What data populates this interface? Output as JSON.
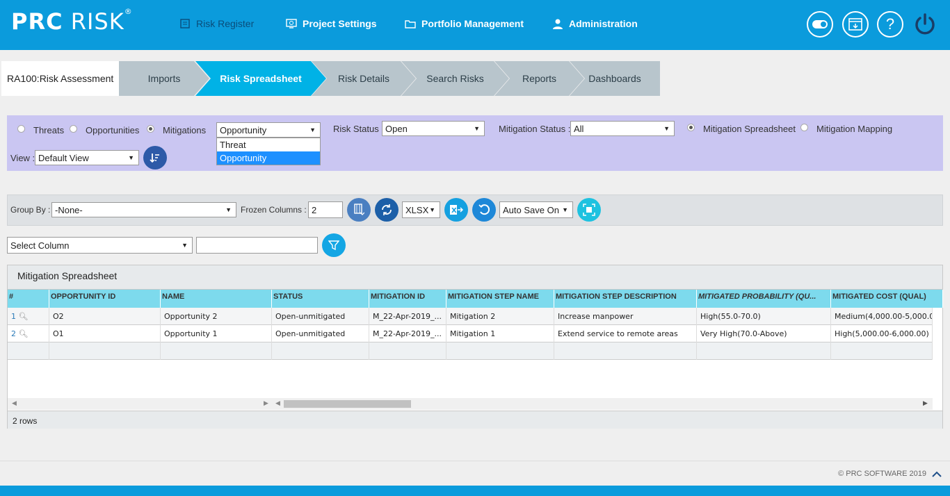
{
  "app": {
    "logo_bold": "PRC",
    "logo_light": " RISK",
    "logo_reg": "®"
  },
  "nav": [
    {
      "label": "Risk Register",
      "icon": "list-icon"
    },
    {
      "label": "Project Settings",
      "icon": "settings-monitor-icon"
    },
    {
      "label": "Portfolio Management",
      "icon": "folder-icon"
    },
    {
      "label": "Administration",
      "icon": "user-icon"
    }
  ],
  "top_icons": [
    "toggle-icon",
    "window-icon",
    "help-icon",
    "power-icon"
  ],
  "tabs": {
    "current": "RA100:Risk Assessment",
    "items": [
      "Imports",
      "Risk Spreadsheet",
      "Risk Details",
      "Search Risks",
      "Reports",
      "Dashboards"
    ],
    "active": "Risk Spreadsheet"
  },
  "filters": {
    "radio_threats": "Threats",
    "radio_opportunities": "Opportunities",
    "radio_mitigations": "Mitigations",
    "type_select": "Opportunity",
    "type_options": [
      "Threat",
      "Opportunity"
    ],
    "risk_status_label": "Risk Status :",
    "risk_status": "Open",
    "mitigation_status_label": "Mitigation Status :",
    "mitigation_status": "All",
    "radio_spreadsheet": "Mitigation Spreadsheet",
    "radio_mapping": "Mitigation Mapping",
    "view_label": "View :",
    "view": "Default View"
  },
  "toolbar": {
    "group_by_label": "Group By :",
    "group_by": "-None-",
    "frozen_label": "Frozen Columns :",
    "frozen_value": "2",
    "export_format": "XLSX",
    "auto_save": "Auto Save On"
  },
  "column_filter": {
    "select": "Select Column",
    "value": ""
  },
  "grid": {
    "title": "Mitigation Spreadsheet",
    "columns": [
      "#",
      "OPPORTUNITY ID",
      "NAME",
      "STATUS",
      "MITIGATION ID",
      "MITIGATION STEP NAME",
      "MITIGATION STEP DESCRIPTION",
      "MITIGATED PROBABILITY (QU...",
      "MITIGATED COST (QUAL)"
    ],
    "rows": [
      [
        "1",
        "O2",
        "Opportunity 2",
        "Open-unmitigated",
        "M_22-Apr-2019_...",
        "Mitigation 2",
        "Increase manpower",
        "High(55.0-70.0)",
        "Medium(4,000.00-5,000.00"
      ],
      [
        "2",
        "O1",
        "Opportunity 1",
        "Open-unmitigated",
        "M_22-Apr-2019_...",
        "Mitigation 1",
        "Extend service to remote areas",
        "Very High(70.0-Above)",
        "High(5,000.00-6,000.00)"
      ]
    ],
    "footer": "2 rows"
  },
  "footer": {
    "copyright": "© PRC SOFTWARE 2019"
  }
}
